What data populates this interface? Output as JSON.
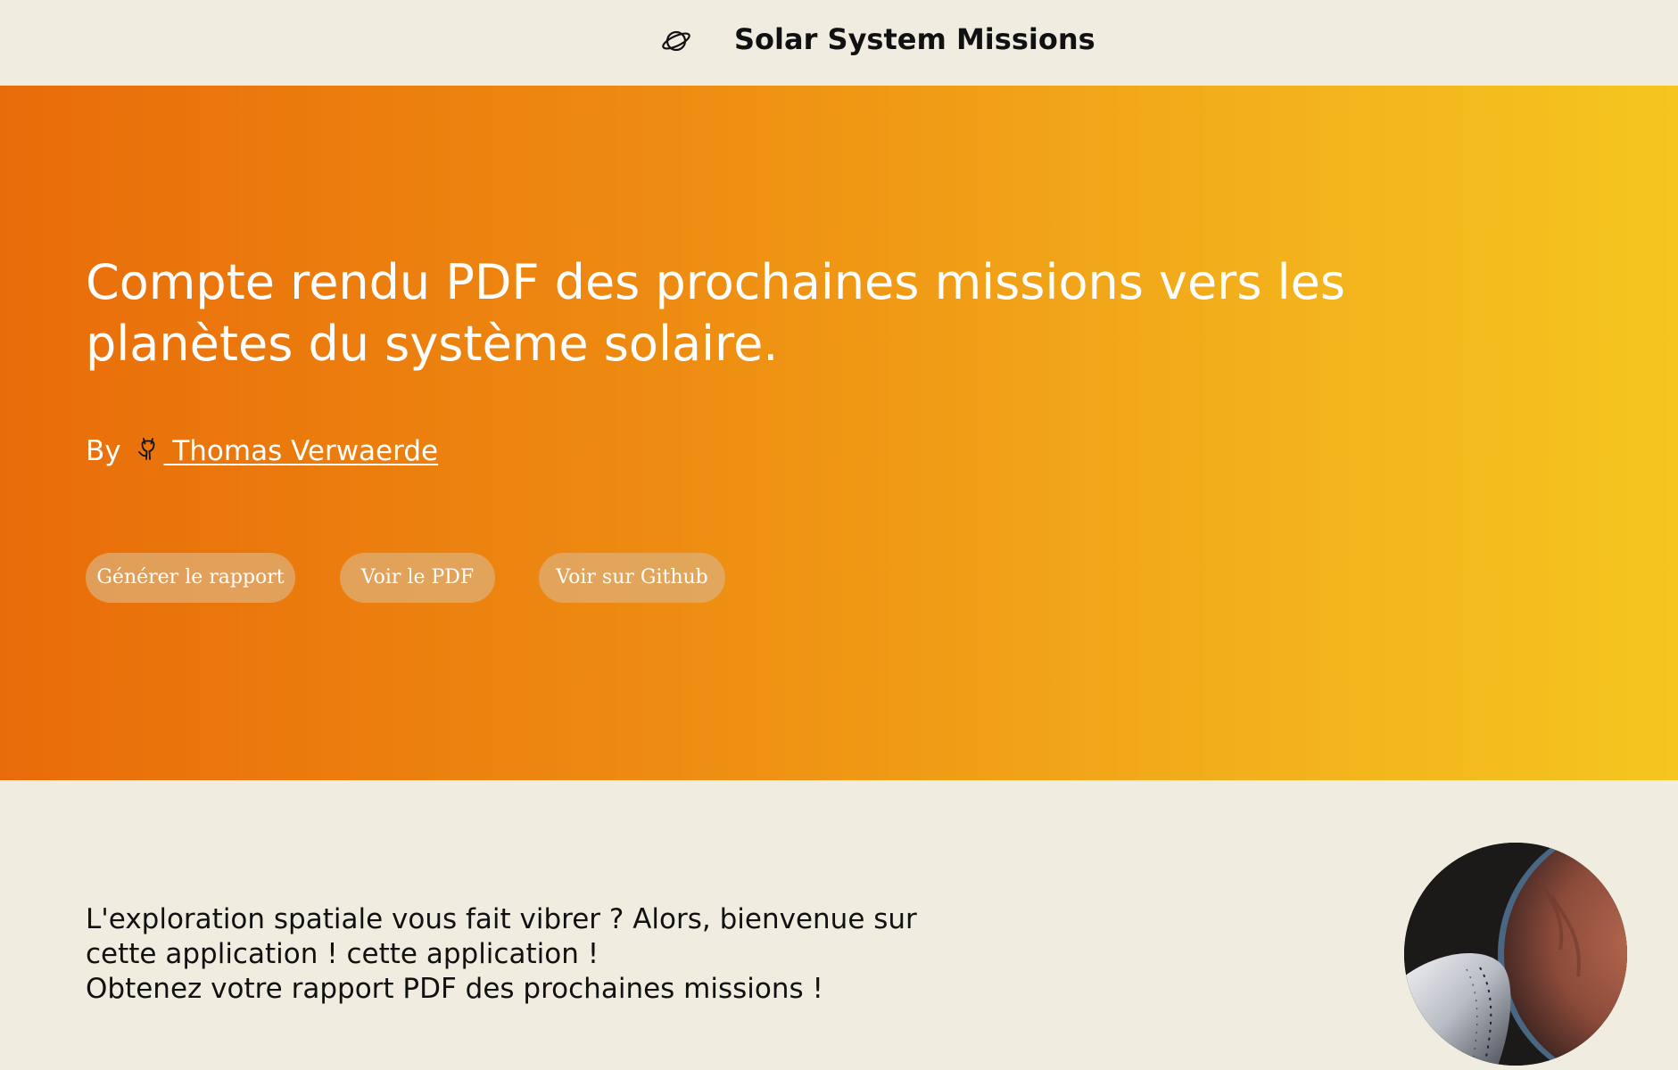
{
  "header": {
    "title": "Solar System Missions",
    "icon": "planet-icon"
  },
  "hero": {
    "title": "Compte rendu PDF des prochaines missions vers les planètes du système solaire.",
    "byline_prefix": "By",
    "author_icon": "github-icon",
    "author_name": " Thomas Verwaerde",
    "buttons": {
      "generate": "Générer le rapport",
      "view_pdf": "Voir le PDF",
      "github": "Voir sur Github"
    },
    "gradient_colors": [
      "#e96c0a",
      "#f5c61f"
    ]
  },
  "intro": {
    "line1": "L'exploration spatiale vous fait vibrer ? Alors, bienvenue sur",
    "line2": "cette application ! cette application !",
    "line3": "Obtenez votre rapport PDF des prochaines missions !"
  },
  "illustration": {
    "icon": "mars-spaceship-image"
  }
}
